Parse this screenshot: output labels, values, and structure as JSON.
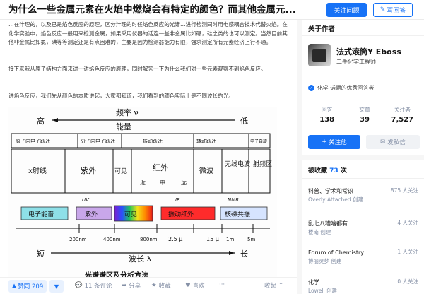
{
  "header": {
    "question_title": "为什么一些金属元素在火焰中燃烧会有特定的颜色？而其他金属元...",
    "follow_question": "关注问题",
    "write_answer": "写回答"
  },
  "article": {
    "para1": "…在汁理的，以及已是焰色反应的原理，区分汁理的时候焰色反应的光谱…进行检测同时用电感耦合技术代替火焰。在化学实验中，焰色反应一般用来检测金属，如果采用仪器的话连一些非金属比如硼，硅之类的也可以测定。当然目前其他非金属比如氯，碘等等测定还是有点困难的，主要是因为检测器能力有限，强求测定所有元素经济上行不通。",
    "para2": "接下来我从原子结构方面来讲一讲焰色反应的原理，同时解答一下为什么我们对一些元素观察不到焰色反应。",
    "para3": "讲焰色反应，我们先从颜色的本质讲起，大家都知道，我们看到的颜色实际上是不同波长的光。"
  },
  "diagram": {
    "top_label": "频率 ν",
    "high": "高",
    "energy": "能量",
    "low": "低",
    "row_headers": [
      "原子内电子跃迁",
      "分子内电子跃迁",
      "振动跃迁",
      "转动跃迁",
      "电子自旋"
    ],
    "regions": [
      "x射线",
      "紫外",
      "可见",
      "红外",
      "微波",
      "无线电波",
      "射频区"
    ],
    "ir_sub": [
      "近",
      "中",
      "远"
    ],
    "spec_tags": [
      "UV",
      "IR",
      "NMR"
    ],
    "techniques": [
      "电子能谱",
      "紫外",
      "可见",
      "振动红外",
      "核磁共振"
    ],
    "wavelengths": [
      "200nm",
      "400nm",
      "800nm",
      "2.5 μ",
      "15 μ",
      "1m",
      "5m"
    ],
    "short": "短",
    "wave_label": "波长 λ",
    "long": "长",
    "footer": "光谱谱区及分析方法"
  },
  "actions": {
    "upvote": "赞同 209",
    "comments": "11 条评论",
    "share": "分享",
    "favorite": "收藏",
    "like": "喜欢",
    "more": "···",
    "collapse": "收起"
  },
  "author": {
    "section_title": "关于作者",
    "name": "法式滚筒Y Eboss",
    "bio": "二手化学工程师",
    "badge": "化学 话题的优秀回答者",
    "stats": [
      {
        "label": "回答",
        "value": "138"
      },
      {
        "label": "文章",
        "value": "39"
      },
      {
        "label": "关注者",
        "value": "7,527"
      }
    ],
    "follow_btn": "关注他",
    "message_btn": "发私信"
  },
  "collections": {
    "title_prefix": "被收藏",
    "count": "73",
    "title_suffix": "次",
    "items": [
      {
        "title": "科普、学术和常识",
        "right": "875 人关注",
        "sub": "Overly Attached 创建"
      },
      {
        "title": "乱七八糟啥都有",
        "right": "4 人关注",
        "sub": "楼南 创建"
      },
      {
        "title": "Forum of Chemistry",
        "right": "1 人关注",
        "sub": "博丽灵梦 创建"
      },
      {
        "title": "化学",
        "right": "0 人关注",
        "sub": "Lowell 创建"
      }
    ]
  },
  "colors": {
    "accent": "#1772f6",
    "muted": "#8590a6"
  }
}
